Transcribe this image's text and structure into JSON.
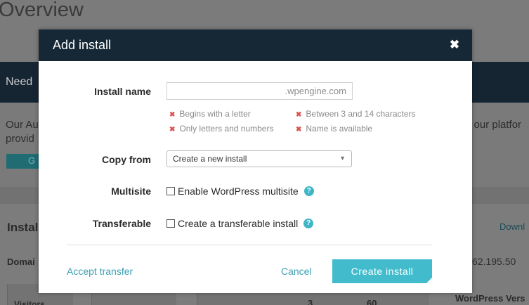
{
  "background": {
    "title": "Overview",
    "dark_banner_text": "Need",
    "band_text_1": "Our Au",
    "band_text_2": "provid",
    "band_text_right": "o our platfor",
    "teal_button_text": "G",
    "section_heading": "Instal",
    "right_link": "Downl",
    "domain_label": "Domai",
    "ip_text": "62.195.50",
    "visitors_label": "Visitors",
    "num_3": "3",
    "num_60": "60",
    "wp_version_label": "WordPress Vers"
  },
  "modal": {
    "title": "Add install",
    "close_glyph": "✖",
    "install_name_label": "Install name",
    "install_name_value": "",
    "domain_suffix": ".wpengine.com",
    "rules": [
      "Begins with a letter",
      "Between 3 and 14 characters",
      "Only letters and numbers",
      "Name is available"
    ],
    "rule_glyph": "✖",
    "copy_from_label": "Copy from",
    "copy_from_value": "Create a new install",
    "caret_glyph": "▼",
    "multisite_label": "Multisite",
    "multisite_checkbox_label": "Enable WordPress multisite",
    "transferable_label": "Transferable",
    "transferable_checkbox_label": "Create a transferable install",
    "help_glyph": "?",
    "accept_transfer": "Accept transfer",
    "cancel": "Cancel",
    "create_install": "Create install"
  }
}
